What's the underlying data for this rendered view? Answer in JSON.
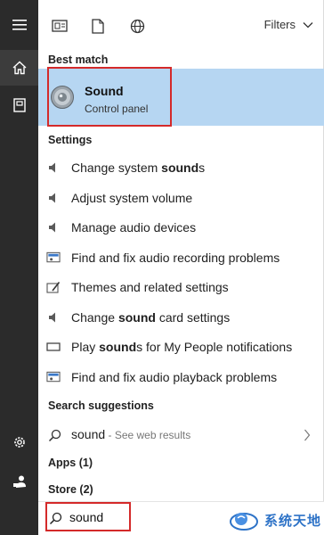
{
  "toolbar": {
    "filters_label": "Filters",
    "icons": [
      "apps-icon",
      "documents-icon",
      "web-icon"
    ]
  },
  "sections": {
    "best_match": "Best match",
    "settings": "Settings",
    "search_suggestions": "Search suggestions",
    "apps": "Apps (1)",
    "store": "Store (2)"
  },
  "best_match": {
    "title": "Sound",
    "subtitle": "Control panel"
  },
  "settings_items": [
    {
      "pre": "Change system ",
      "bold": "sound",
      "post": "s",
      "icon": "speaker-icon"
    },
    {
      "pre": "Adjust system volume",
      "bold": "",
      "post": "",
      "icon": "speaker-icon"
    },
    {
      "pre": "Manage audio devices",
      "bold": "",
      "post": "",
      "icon": "speaker-icon"
    },
    {
      "pre": "Find and fix audio recording problems",
      "bold": "",
      "post": "",
      "icon": "troubleshoot-icon"
    },
    {
      "pre": "Themes and related settings",
      "bold": "",
      "post": "",
      "icon": "themes-icon"
    },
    {
      "pre": "Change ",
      "bold": "sound",
      "post": " card settings",
      "icon": "speaker-icon"
    },
    {
      "pre": "Play ",
      "bold": "sound",
      "post": "s for My People notifications",
      "icon": "notification-icon"
    },
    {
      "pre": "Find and fix audio playback problems",
      "bold": "",
      "post": "",
      "icon": "troubleshoot-icon"
    }
  ],
  "suggestion": {
    "query": "sound",
    "hint": " - See web results"
  },
  "search": {
    "value": "sound"
  },
  "watermark": {
    "text": "系统天地"
  },
  "colors": {
    "rail": "#2b2b2b",
    "highlight": "#b6d6f2",
    "annotation": "#d42a2a",
    "watermark": "#2e73c7"
  }
}
